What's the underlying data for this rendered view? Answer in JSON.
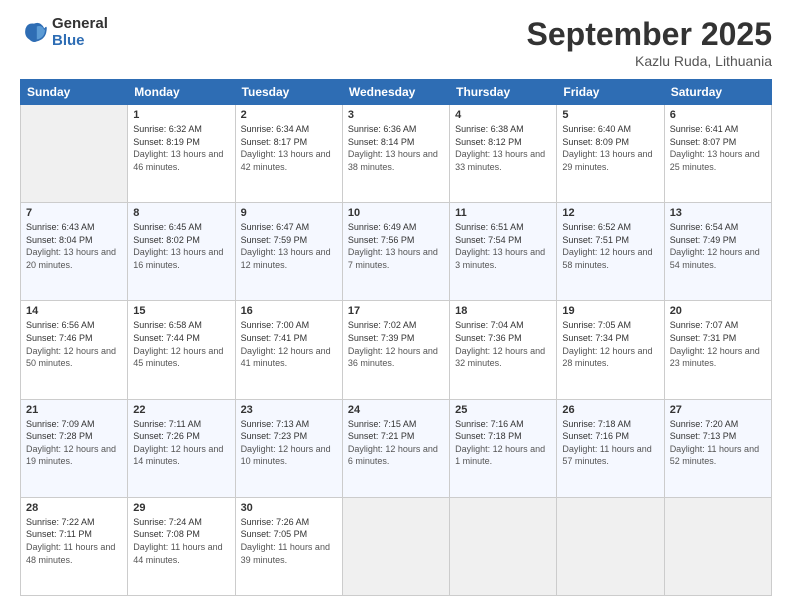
{
  "logo": {
    "general": "General",
    "blue": "Blue"
  },
  "title": {
    "month": "September 2025",
    "location": "Kazlu Ruda, Lithuania"
  },
  "headers": [
    "Sunday",
    "Monday",
    "Tuesday",
    "Wednesday",
    "Thursday",
    "Friday",
    "Saturday"
  ],
  "weeks": [
    [
      {
        "day": "",
        "sunrise": "",
        "sunset": "",
        "daylight": ""
      },
      {
        "day": "1",
        "sunrise": "Sunrise: 6:32 AM",
        "sunset": "Sunset: 8:19 PM",
        "daylight": "Daylight: 13 hours and 46 minutes."
      },
      {
        "day": "2",
        "sunrise": "Sunrise: 6:34 AM",
        "sunset": "Sunset: 8:17 PM",
        "daylight": "Daylight: 13 hours and 42 minutes."
      },
      {
        "day": "3",
        "sunrise": "Sunrise: 6:36 AM",
        "sunset": "Sunset: 8:14 PM",
        "daylight": "Daylight: 13 hours and 38 minutes."
      },
      {
        "day": "4",
        "sunrise": "Sunrise: 6:38 AM",
        "sunset": "Sunset: 8:12 PM",
        "daylight": "Daylight: 13 hours and 33 minutes."
      },
      {
        "day": "5",
        "sunrise": "Sunrise: 6:40 AM",
        "sunset": "Sunset: 8:09 PM",
        "daylight": "Daylight: 13 hours and 29 minutes."
      },
      {
        "day": "6",
        "sunrise": "Sunrise: 6:41 AM",
        "sunset": "Sunset: 8:07 PM",
        "daylight": "Daylight: 13 hours and 25 minutes."
      }
    ],
    [
      {
        "day": "7",
        "sunrise": "Sunrise: 6:43 AM",
        "sunset": "Sunset: 8:04 PM",
        "daylight": "Daylight: 13 hours and 20 minutes."
      },
      {
        "day": "8",
        "sunrise": "Sunrise: 6:45 AM",
        "sunset": "Sunset: 8:02 PM",
        "daylight": "Daylight: 13 hours and 16 minutes."
      },
      {
        "day": "9",
        "sunrise": "Sunrise: 6:47 AM",
        "sunset": "Sunset: 7:59 PM",
        "daylight": "Daylight: 13 hours and 12 minutes."
      },
      {
        "day": "10",
        "sunrise": "Sunrise: 6:49 AM",
        "sunset": "Sunset: 7:56 PM",
        "daylight": "Daylight: 13 hours and 7 minutes."
      },
      {
        "day": "11",
        "sunrise": "Sunrise: 6:51 AM",
        "sunset": "Sunset: 7:54 PM",
        "daylight": "Daylight: 13 hours and 3 minutes."
      },
      {
        "day": "12",
        "sunrise": "Sunrise: 6:52 AM",
        "sunset": "Sunset: 7:51 PM",
        "daylight": "Daylight: 12 hours and 58 minutes."
      },
      {
        "day": "13",
        "sunrise": "Sunrise: 6:54 AM",
        "sunset": "Sunset: 7:49 PM",
        "daylight": "Daylight: 12 hours and 54 minutes."
      }
    ],
    [
      {
        "day": "14",
        "sunrise": "Sunrise: 6:56 AM",
        "sunset": "Sunset: 7:46 PM",
        "daylight": "Daylight: 12 hours and 50 minutes."
      },
      {
        "day": "15",
        "sunrise": "Sunrise: 6:58 AM",
        "sunset": "Sunset: 7:44 PM",
        "daylight": "Daylight: 12 hours and 45 minutes."
      },
      {
        "day": "16",
        "sunrise": "Sunrise: 7:00 AM",
        "sunset": "Sunset: 7:41 PM",
        "daylight": "Daylight: 12 hours and 41 minutes."
      },
      {
        "day": "17",
        "sunrise": "Sunrise: 7:02 AM",
        "sunset": "Sunset: 7:39 PM",
        "daylight": "Daylight: 12 hours and 36 minutes."
      },
      {
        "day": "18",
        "sunrise": "Sunrise: 7:04 AM",
        "sunset": "Sunset: 7:36 PM",
        "daylight": "Daylight: 12 hours and 32 minutes."
      },
      {
        "day": "19",
        "sunrise": "Sunrise: 7:05 AM",
        "sunset": "Sunset: 7:34 PM",
        "daylight": "Daylight: 12 hours and 28 minutes."
      },
      {
        "day": "20",
        "sunrise": "Sunrise: 7:07 AM",
        "sunset": "Sunset: 7:31 PM",
        "daylight": "Daylight: 12 hours and 23 minutes."
      }
    ],
    [
      {
        "day": "21",
        "sunrise": "Sunrise: 7:09 AM",
        "sunset": "Sunset: 7:28 PM",
        "daylight": "Daylight: 12 hours and 19 minutes."
      },
      {
        "day": "22",
        "sunrise": "Sunrise: 7:11 AM",
        "sunset": "Sunset: 7:26 PM",
        "daylight": "Daylight: 12 hours and 14 minutes."
      },
      {
        "day": "23",
        "sunrise": "Sunrise: 7:13 AM",
        "sunset": "Sunset: 7:23 PM",
        "daylight": "Daylight: 12 hours and 10 minutes."
      },
      {
        "day": "24",
        "sunrise": "Sunrise: 7:15 AM",
        "sunset": "Sunset: 7:21 PM",
        "daylight": "Daylight: 12 hours and 6 minutes."
      },
      {
        "day": "25",
        "sunrise": "Sunrise: 7:16 AM",
        "sunset": "Sunset: 7:18 PM",
        "daylight": "Daylight: 12 hours and 1 minute."
      },
      {
        "day": "26",
        "sunrise": "Sunrise: 7:18 AM",
        "sunset": "Sunset: 7:16 PM",
        "daylight": "Daylight: 11 hours and 57 minutes."
      },
      {
        "day": "27",
        "sunrise": "Sunrise: 7:20 AM",
        "sunset": "Sunset: 7:13 PM",
        "daylight": "Daylight: 11 hours and 52 minutes."
      }
    ],
    [
      {
        "day": "28",
        "sunrise": "Sunrise: 7:22 AM",
        "sunset": "Sunset: 7:11 PM",
        "daylight": "Daylight: 11 hours and 48 minutes."
      },
      {
        "day": "29",
        "sunrise": "Sunrise: 7:24 AM",
        "sunset": "Sunset: 7:08 PM",
        "daylight": "Daylight: 11 hours and 44 minutes."
      },
      {
        "day": "30",
        "sunrise": "Sunrise: 7:26 AM",
        "sunset": "Sunset: 7:05 PM",
        "daylight": "Daylight: 11 hours and 39 minutes."
      },
      {
        "day": "",
        "sunrise": "",
        "sunset": "",
        "daylight": ""
      },
      {
        "day": "",
        "sunrise": "",
        "sunset": "",
        "daylight": ""
      },
      {
        "day": "",
        "sunrise": "",
        "sunset": "",
        "daylight": ""
      },
      {
        "day": "",
        "sunrise": "",
        "sunset": "",
        "daylight": ""
      }
    ]
  ]
}
